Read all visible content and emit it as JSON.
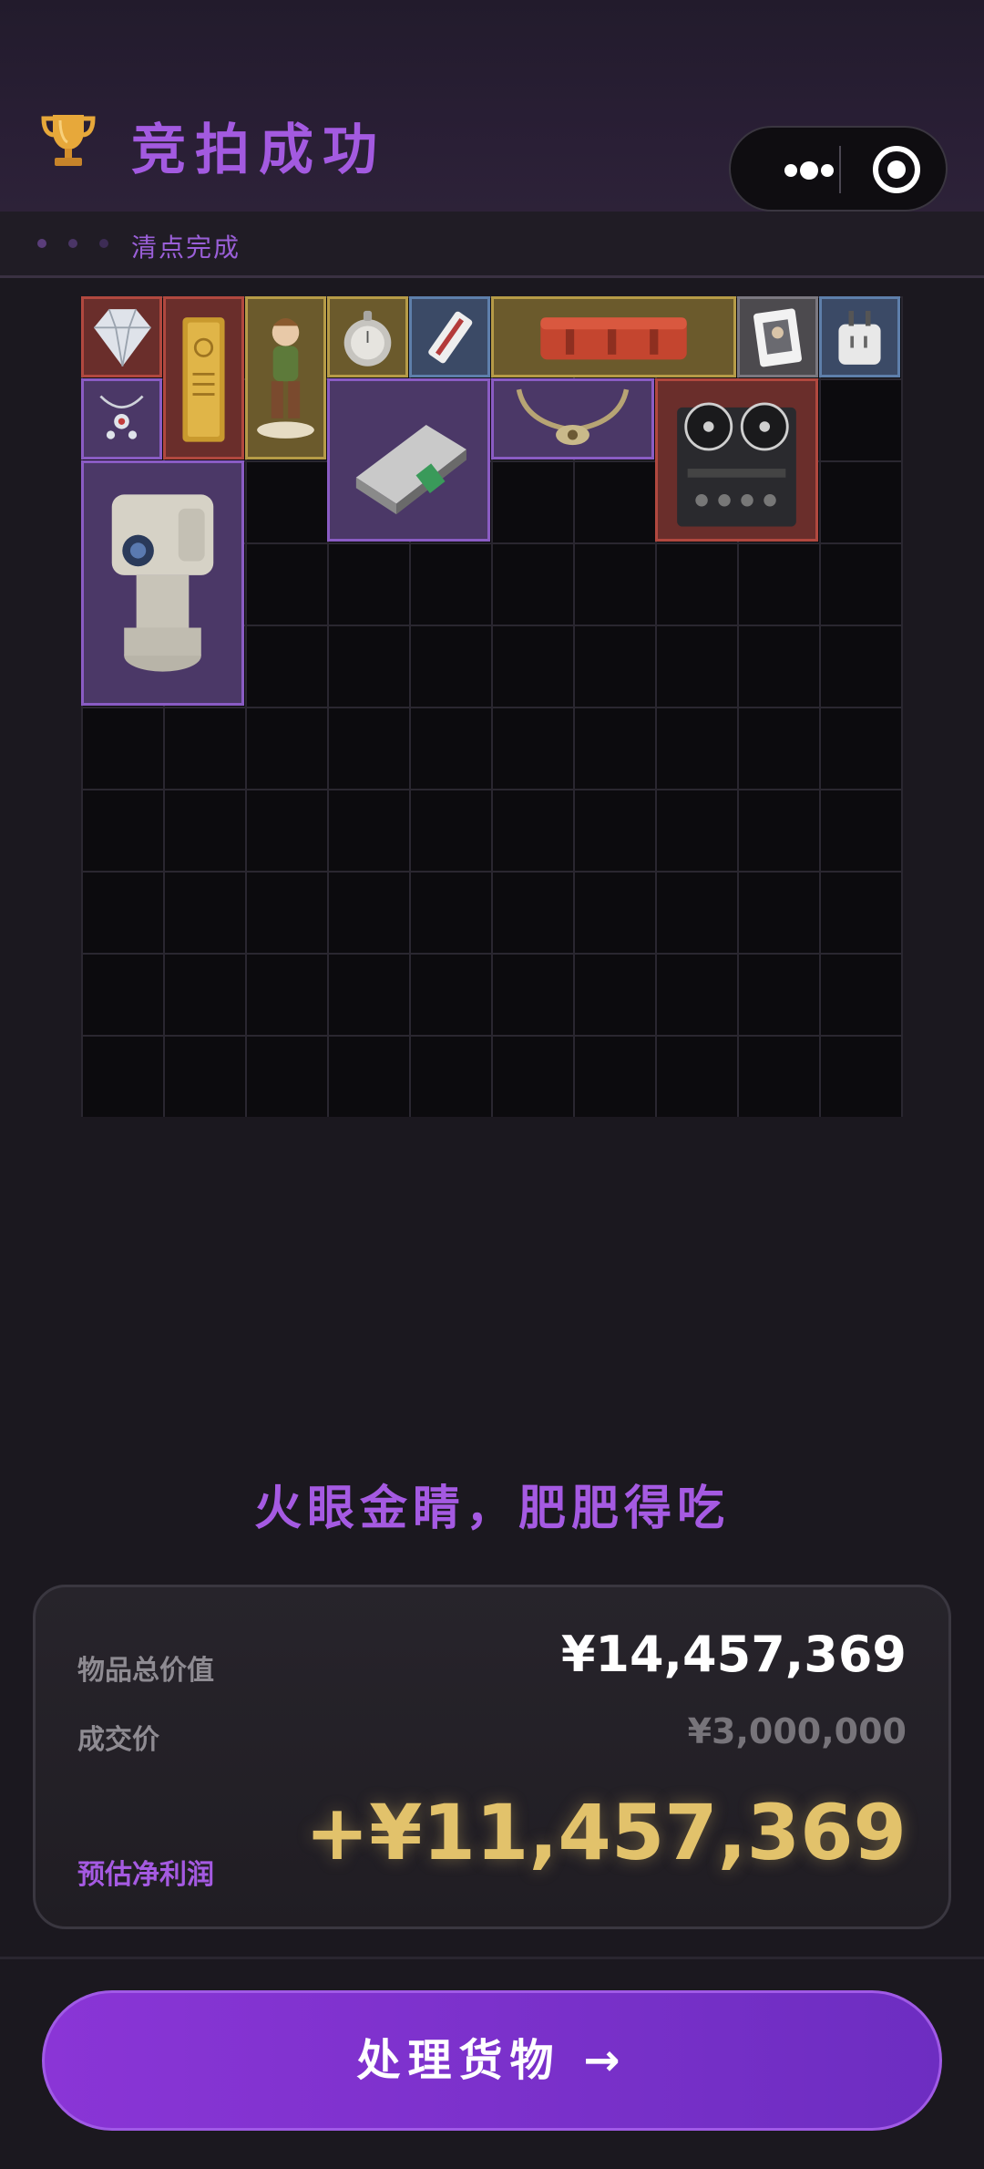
{
  "header": {
    "title": "竞拍成功",
    "icon": "trophy-icon",
    "capsule": {
      "more_icon": "more-dots-icon",
      "close_icon": "target-close-icon"
    }
  },
  "sub_header": {
    "label": "清点完成"
  },
  "inventory": {
    "columns": 10,
    "rows": 10,
    "items": [
      {
        "name": "diamond",
        "rarity": "red"
      },
      {
        "name": "gold-bar",
        "rarity": "red"
      },
      {
        "name": "figurine",
        "rarity": "gold"
      },
      {
        "name": "pocket-watch",
        "rarity": "gold"
      },
      {
        "name": "card-key",
        "rarity": "blue"
      },
      {
        "name": "red-case",
        "rarity": "gold"
      },
      {
        "name": "playing-card",
        "rarity": "gray"
      },
      {
        "name": "power-adapter",
        "rarity": "blue"
      },
      {
        "name": "jewel-pendant",
        "rarity": "purple"
      },
      {
        "name": "router",
        "rarity": "purple"
      },
      {
        "name": "horn-necklace",
        "rarity": "purple"
      },
      {
        "name": "reel-recorder",
        "rarity": "red"
      },
      {
        "name": "camera-turret",
        "rarity": "purple"
      }
    ]
  },
  "slogan": "火眼金睛，肥肥得吃",
  "summary": {
    "total_value_label": "物品总价值",
    "total_value": "¥14,457,369",
    "deal_price_label": "成交价",
    "deal_price": "¥3,000,000",
    "profit_label": "预估净利润",
    "profit": "+¥11,457,369"
  },
  "cta": {
    "label": "处理货物 →"
  },
  "colors": {
    "accent": "#a55ae2",
    "profit": "#e2c26b",
    "background": "#1b181f"
  }
}
